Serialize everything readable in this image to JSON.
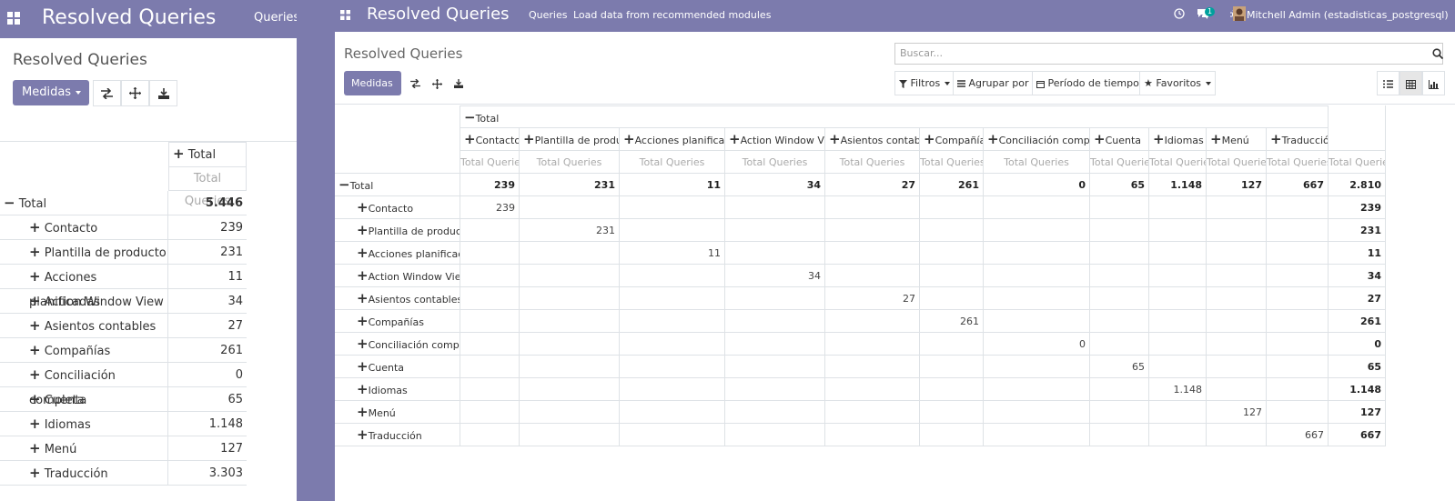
{
  "left": {
    "app_title": "Resolved Queries",
    "menu": "Queries",
    "breadcrumb": "Resolved Queries",
    "measures_label": "Medidas",
    "col_header": "Total",
    "measure_header": "Total Queries",
    "total_label": "Total",
    "total_value": "5.446",
    "rows": [
      {
        "label": "Contacto",
        "value": "239"
      },
      {
        "label": "Plantilla de producto",
        "value": "231"
      },
      {
        "label": "Acciones planificadas",
        "value": "11"
      },
      {
        "label": "Action Window View",
        "value": "34"
      },
      {
        "label": "Asientos contables",
        "value": "27"
      },
      {
        "label": "Compañías",
        "value": "261"
      },
      {
        "label": "Conciliación completa",
        "value": "0"
      },
      {
        "label": "Cuenta",
        "value": "65"
      },
      {
        "label": "Idiomas",
        "value": "1.148"
      },
      {
        "label": "Menú",
        "value": "127"
      },
      {
        "label": "Traducción",
        "value": "3.303"
      }
    ]
  },
  "right": {
    "app_title": "Resolved Queries",
    "menu": [
      "Queries",
      "Load data from recommended modules"
    ],
    "chat_badge": "1",
    "user": "Mitchell Admin (estadisticas_postgresql)",
    "breadcrumb": "Resolved Queries",
    "search_placeholder": "Buscar...",
    "measures_label": "Medidas",
    "filters": {
      "filtros": "Filtros",
      "agrupar": "Agrupar por",
      "periodo": "Período de tiempo",
      "favoritos": "Favoritos"
    },
    "pivot": {
      "col_total": "Total",
      "measure": "Total Queries",
      "row_total": "Total",
      "columns": [
        "Contacto",
        "Plantilla de producto",
        "Acciones planificadas",
        "Action Window View",
        "Asientos contables",
        "Compañías",
        "Conciliación completa",
        "Cuenta",
        "Idiomas",
        "Menú",
        "Traducción"
      ],
      "total_row": [
        "239",
        "231",
        "11",
        "34",
        "27",
        "261",
        "0",
        "65",
        "1.148",
        "127",
        "667",
        "2.810"
      ],
      "rows": [
        {
          "label": "Contacto",
          "value": "239",
          "total": "239"
        },
        {
          "label": "Plantilla de producto",
          "value": "231",
          "total": "231"
        },
        {
          "label": "Acciones planificadas",
          "value": "11",
          "total": "11"
        },
        {
          "label": "Action Window View",
          "value": "34",
          "total": "34"
        },
        {
          "label": "Asientos contables",
          "value": "27",
          "total": "27"
        },
        {
          "label": "Compañías",
          "value": "261",
          "total": "261"
        },
        {
          "label": "Conciliación completa",
          "value": "0",
          "total": "0"
        },
        {
          "label": "Cuenta",
          "value": "65",
          "total": "65"
        },
        {
          "label": "Idiomas",
          "value": "1.148",
          "total": "1.148"
        },
        {
          "label": "Menú",
          "value": "127",
          "total": "127"
        },
        {
          "label": "Traducción",
          "value": "667",
          "total": "667"
        }
      ]
    }
  }
}
